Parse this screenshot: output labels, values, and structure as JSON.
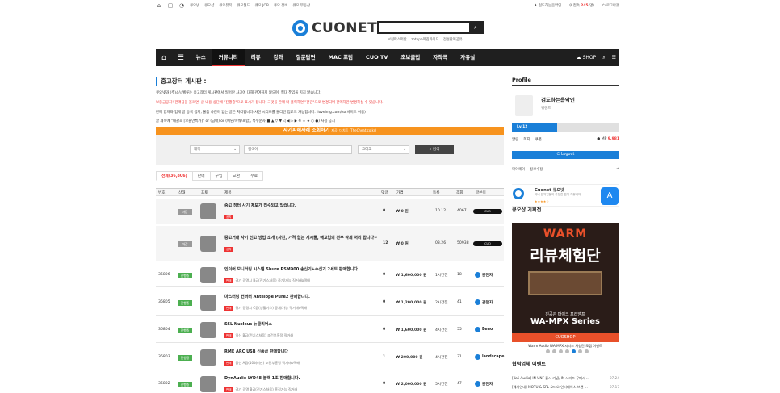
{
  "topbar": {
    "links": [
      "큐오넷",
      "큐오샵",
      "큐오뮤직",
      "큐오월드",
      "큐오 JOB",
      "큐오 정비",
      "큐오 부동산"
    ],
    "user": "검도하는음악인",
    "visits_label": "접속",
    "visits_count": "245",
    "visits_suffix": "명",
    "logout": "로그아웃"
  },
  "logo": {
    "text": "CUONET"
  },
  "search": {
    "placeholder": "",
    "sublinks": [
      "보컬마스퍼반",
      "zotope마김가이드",
      "전설판매공유"
    ]
  },
  "nav": {
    "items": [
      "뉴스",
      "커뮤니티",
      "리뷰",
      "강좌",
      "질문답변",
      "MAC 포럼",
      "CUO TV",
      "초보클럽",
      "자작곡",
      "자유실"
    ],
    "active_index": 1,
    "shop": "SHOP"
  },
  "board": {
    "title": "중고장터 게시판 :",
    "notices": [
      "큐오넷과 (주)소닉벨류는 중고장터 게시판에서 일어난 사고에 대해 관여하지 않으며, 절대 책임을 지지 않습니다.",
      "보증금공지! 판매금을 올리면, 글 내용 상단에 \"진행중\"으로 표시가 됩니다. 그것을 판매 더 클릭하면 \"판감\"으로 변경되며 판매처만 변경하실 수 있습니다.",
      "판매 업자와 업체 글 등록 금지, 물품 사진이 없는 글은 처리됩니다(사진 시리즈를 올리면 업로드 가능합니다. iloveimg.com/ko 사이트 이용)",
      "글 제목에 \"대괄호 [오늘만특가]\" or (급매) or (예님/마워/포함), 특수문자(■ ▲ ▽ ▼ ◁ ◀ ▷ ▶ ※ ☆ ★ ○ ●) 사용 금지"
    ],
    "orange_banner": "사기피해사례 조회하기",
    "orange_sub": "제공: 더치트 (TheCheat.co.kr)",
    "filter": {
      "field": "제목",
      "keyword_placeholder": "검색어",
      "op": "그리고",
      "button": "검색"
    },
    "tabs": [
      "전체(36,806)",
      "판매",
      "구입",
      "교환",
      "무료"
    ],
    "headers": [
      "번호",
      "상태",
      "포토",
      "제목",
      "댓글",
      "가격",
      "등록",
      "조회",
      "글쓴이"
    ],
    "rows": [
      {
        "num": "",
        "status": "마감",
        "status_color": "#999",
        "title": "중고 장터 사기 제보가 접수되고 있습니다.",
        "tag": "공지",
        "meta": "",
        "comments": "0",
        "price": "₩ 0 원",
        "date": "10.12",
        "views": "4067",
        "writer": "CUO",
        "pill": true
      },
      {
        "num": "",
        "status": "마감",
        "status_color": "#999",
        "title": "중고거래 사기 신고 방법 소개 (사진, 가격 없는 게시물, 애교업의 전부 삭제 처리 합니다~",
        "tag": "공지",
        "meta": "",
        "comments": "12",
        "price": "₩ 0 원",
        "date": "03.26",
        "views": "50938",
        "writer": "CUO",
        "pill": true
      },
      {
        "num": "36806",
        "status": "진행중",
        "status_color": "#4caf50",
        "title": "인이어 모니터링 시스템 Shure PSM900 송신기+수신기 2세트 판매합니다.",
        "tag": "판매",
        "meta": "경기 광명시  B급(전기스쳐움)  중개/가능  직거래o택배",
        "comments": "0",
        "price": "₩ 1,600,000 원",
        "date": "1시간전",
        "views": "18",
        "writer": "관천자",
        "pill": false
      },
      {
        "num": "36805",
        "status": "진행중",
        "status_color": "#4caf50",
        "title": "마스터링 컨버터 Antelope Pure2 판매합니다.",
        "tag": "판매",
        "meta": "경기 광명시  C급(생활기스)  중개/가능  직거래o택배",
        "comments": "0",
        "price": "₩ 1,200,000 원",
        "date": "2시간전",
        "views": "41",
        "writer": "관천자",
        "pill": false
      },
      {
        "num": "36804",
        "status": "진행중",
        "status_color": "#4caf50",
        "title": "SSL Nucleus 뉴클리어스",
        "tag": "판매",
        "meta": "일산  B급(전기스쳐움)  조건부흥정  직거래",
        "comments": "0",
        "price": "₩ 1,600,000 원",
        "date": "4시간전",
        "views": "55",
        "writer": "Eeno",
        "pill": false
      },
      {
        "num": "36803",
        "status": "진행중",
        "status_color": "#4caf50",
        "title": "RME ARC USB 신품급 판매합니다",
        "tag": "판매",
        "meta": "울산  A급(10회미만)  조건부흥정  직거래o택배",
        "comments": "1",
        "price": "₩ 200,000 원",
        "date": "4시간전",
        "views": "31",
        "writer": "landscape",
        "pill": false
      },
      {
        "num": "36802",
        "status": "진행중",
        "status_color": "#4caf50",
        "title": "DynAudio LYD48 블랙 1조 판매합니다.",
        "tag": "판매",
        "meta": "경기 광명  B급(전기스쳐움)  흥정가능  직거래",
        "comments": "0",
        "price": "₩ 2,000,000 원",
        "date": "5시간전",
        "views": "47",
        "writer": "관천자",
        "pill": false
      }
    ]
  },
  "sidebar": {
    "profile_title": "Profile",
    "name": "검도하는음악인",
    "grade": "위렌트",
    "level": "Lv.12",
    "level_progress": 0.42,
    "links": [
      "알림",
      "쪽지",
      "쿠폰"
    ],
    "mp_label": "MP",
    "mp_value": "9,981",
    "logout": "Logout",
    "mypage": [
      "마이페이",
      "정보수정"
    ],
    "app_title": "Cuonet 큐오넷",
    "app_desc": "국내 음악인들이 가장한 음악 커뮤니티",
    "app_stars": "★★★★☆",
    "plan_title": "큐오샵 기획전",
    "banner_brand": "WARM",
    "banner_big": "리뷰체험단",
    "banner_line1": "진공관 마이크 프리앰프",
    "banner_line2": "WA-MPX Series",
    "banner_bar": "CUOSHOP",
    "banner_caption": "Warm Audio WA-MPX 시리즈 체험단 모집 이벤트",
    "dots": 7,
    "dot_active": 4,
    "event_title": "협력업체 이벤트",
    "events": [
      {
        "text": "[Kali Audio] IN-UNF 출시 기념, IN 시리즈 구매시 ...",
        "date": "07.24"
      },
      {
        "text": "[웨사인내] MOTU & SPL 오디오 인터페이스 브랜 ...",
        "date": "07.17"
      }
    ]
  }
}
